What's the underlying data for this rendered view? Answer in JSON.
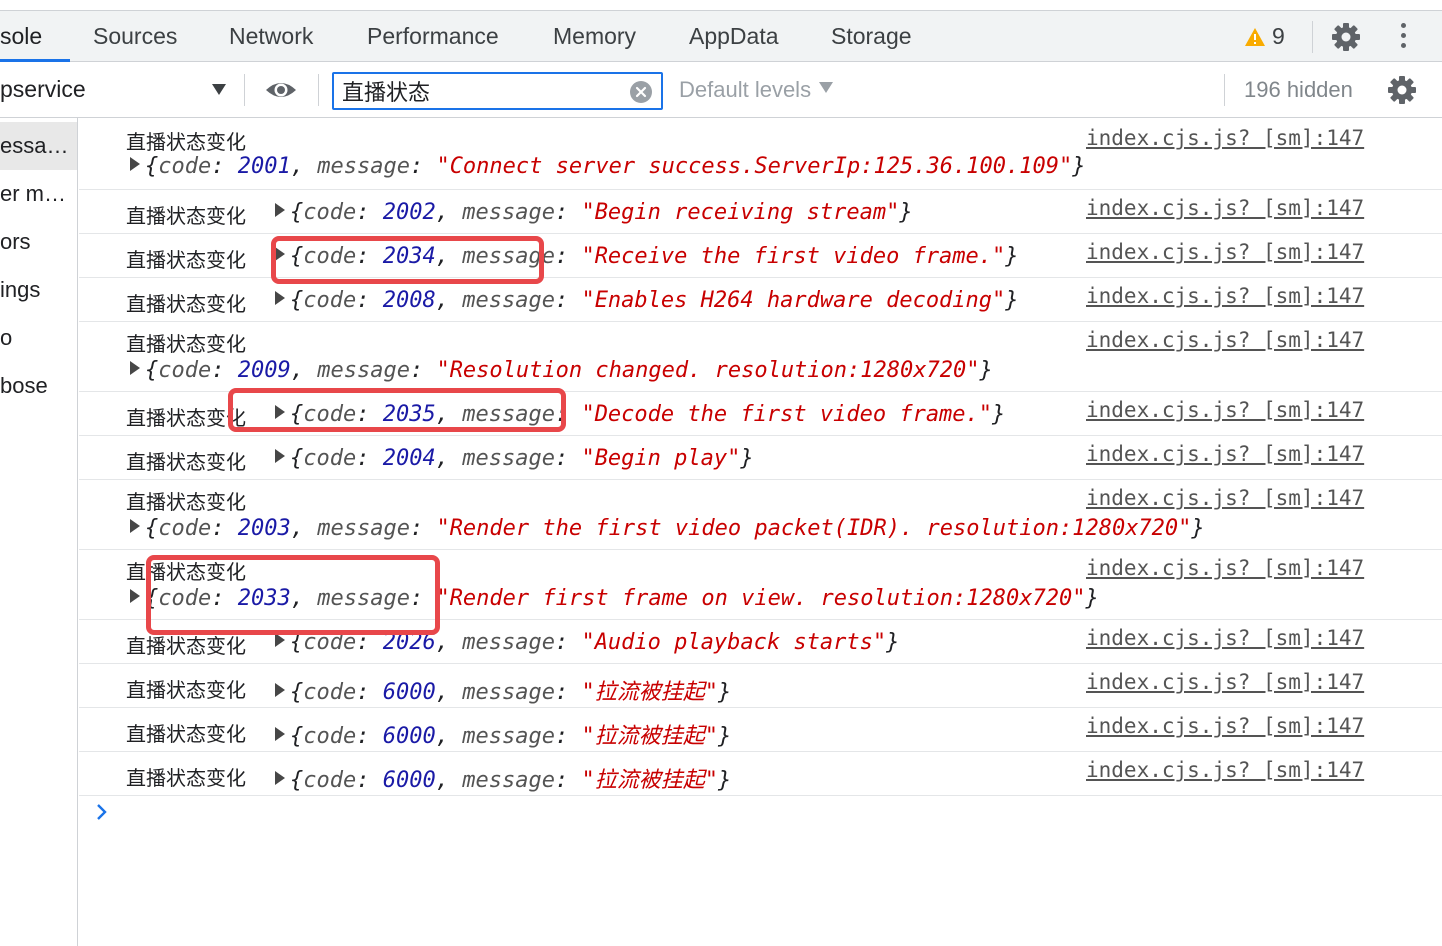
{
  "tabs": [
    {
      "label": "sole",
      "active": true
    },
    {
      "label": "Sources"
    },
    {
      "label": "Network"
    },
    {
      "label": "Performance"
    },
    {
      "label": "Memory"
    },
    {
      "label": "AppData"
    },
    {
      "label": "Storage"
    }
  ],
  "warnings": {
    "count": "9",
    "icon": "warning-triangle-icon"
  },
  "toolbar": {
    "context": "pservice",
    "filter_value": "直播状态",
    "levels": "Default levels",
    "hidden": "196 hidden"
  },
  "sidebar": {
    "items": [
      "essa…",
      "er m…",
      "ors",
      "ings",
      "o",
      "bose"
    ]
  },
  "colors": {
    "accent": "#1a73e8",
    "number": "#1a1aa6",
    "string": "#c80000",
    "highlight_box": "#e8474a",
    "warning": "#f9ab00"
  },
  "messages": [
    {
      "label": "直播状态变化",
      "code": "2001",
      "message": "Connect server success.ServerIp:125.36.100.109",
      "source": "index.cjs.js? [sm]:147"
    },
    {
      "label": "直播状态变化",
      "code": "2002",
      "message": "Begin receiving stream",
      "source": "index.cjs.js? [sm]:147"
    },
    {
      "label": "直播状态变化",
      "code": "2034",
      "message": "Receive the first video frame.",
      "source": "index.cjs.js? [sm]:147"
    },
    {
      "label": "直播状态变化",
      "code": "2008",
      "message": "Enables H264 hardware decoding",
      "source": "index.cjs.js? [sm]:147"
    },
    {
      "label": "直播状态变化",
      "code": "2009",
      "message": "Resolution changed. resolution:1280x720",
      "source": "index.cjs.js? [sm]:147"
    },
    {
      "label": "直播状态变化",
      "code": "2035",
      "message": "Decode the first video frame.",
      "source": "index.cjs.js? [sm]:147"
    },
    {
      "label": "直播状态变化",
      "code": "2004",
      "message": "Begin play",
      "source": "index.cjs.js? [sm]:147"
    },
    {
      "label": "直播状态变化",
      "code": "2003",
      "message": "Render the first video packet(IDR). resolution:1280x720",
      "source": "index.cjs.js? [sm]:147"
    },
    {
      "label": "直播状态变化",
      "code": "2033",
      "message": "Render first frame on view. resolution:1280x720",
      "source": "index.cjs.js? [sm]:147"
    },
    {
      "label": "直播状态变化",
      "code": "2026",
      "message": "Audio playback starts",
      "source": "index.cjs.js? [sm]:147"
    },
    {
      "label": "直播状态变化",
      "code": "6000",
      "message": "拉流被挂起",
      "source": "index.cjs.js? [sm]:147"
    },
    {
      "label": "直播状态变化",
      "code": "6000",
      "message": "拉流被挂起",
      "source": "index.cjs.js? [sm]:147"
    },
    {
      "label": "直播状态变化",
      "code": "6000",
      "message": "拉流被挂起",
      "source": "index.cjs.js? [sm]:147"
    }
  ],
  "icons": {
    "settings": "gear-icon",
    "more": "kebab-menu-icon",
    "eye": "eye-icon",
    "clear": "clear-input-icon",
    "expand": "expand-triangle-icon",
    "prompt": "console-prompt-chevron-icon"
  }
}
